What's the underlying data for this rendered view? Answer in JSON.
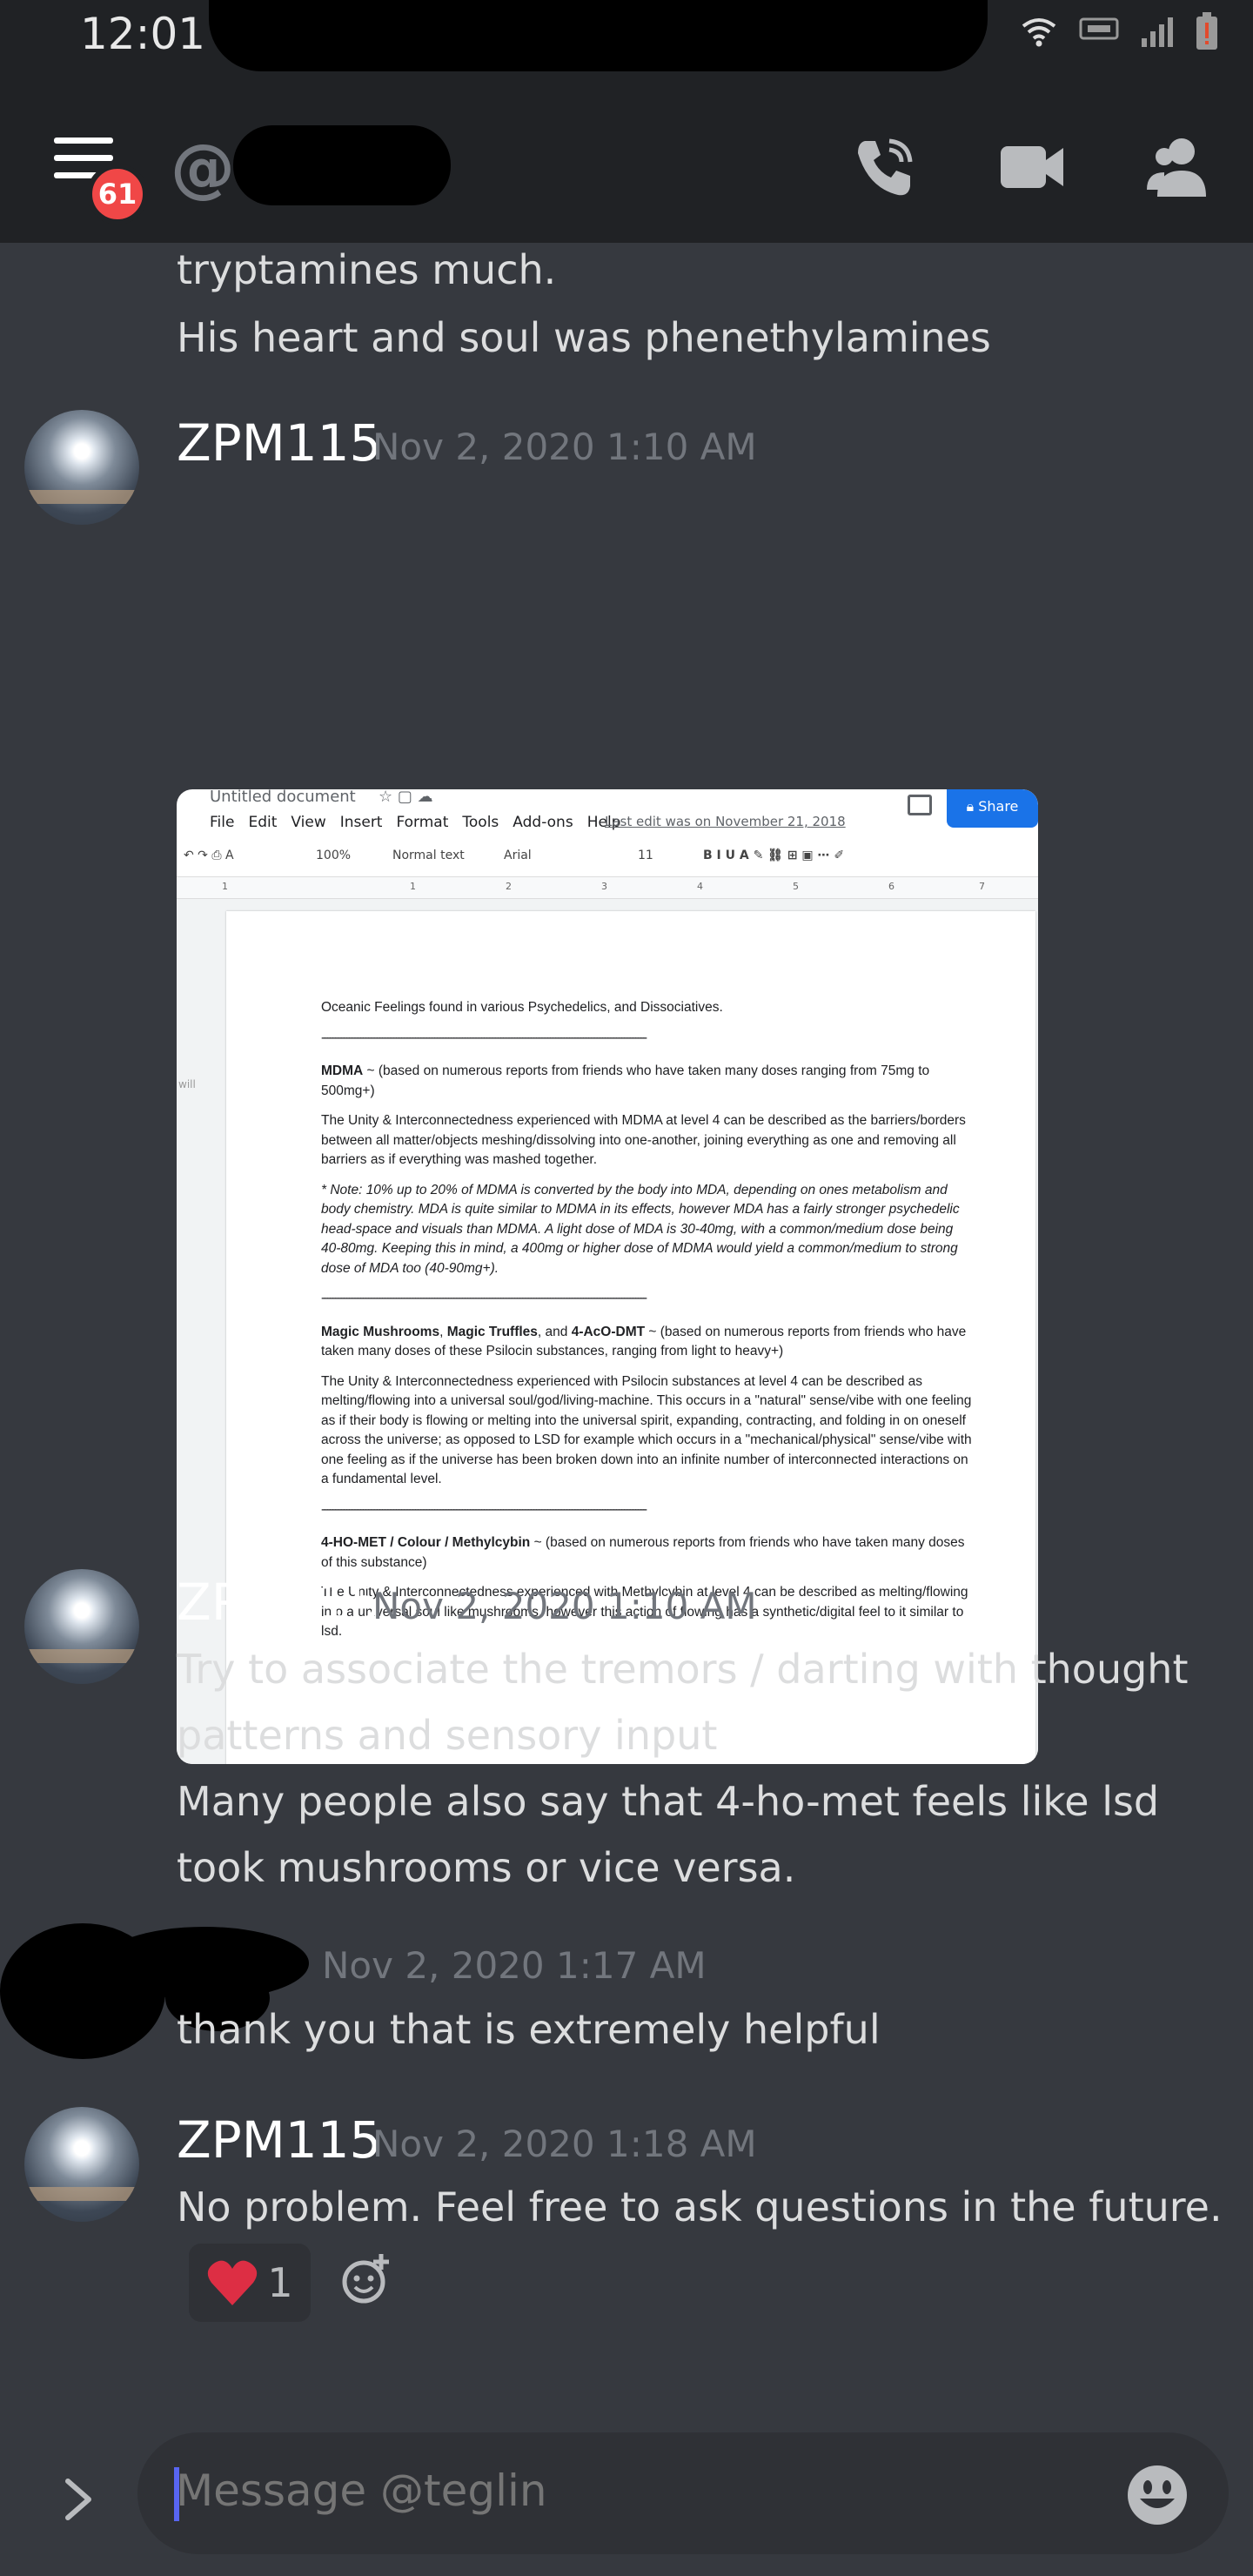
{
  "status_bar": {
    "time": "12:01"
  },
  "header": {
    "unread_badge": "61",
    "at_symbol": "@"
  },
  "messages": {
    "cont_line1": "tryptamines much.",
    "cont_line2": "His heart and soul was phenethylamines",
    "group1": {
      "author": "ZPM115",
      "timestamp": "Nov 2, 2020 1:10 AM"
    },
    "group2": {
      "author": "ZPM115",
      "timestamp": "Nov 2, 2020 1:10 AM",
      "line1": "Try to associate the tremors / darting with thought",
      "line2": "patterns and sensory input",
      "line3": "Many people also say that 4-ho-met feels like lsd",
      "line4": "took mushrooms or vice versa."
    },
    "group3": {
      "timestamp": "Nov 2, 2020 1:17 AM",
      "line1": "thank you that is extremely helpful"
    },
    "group4": {
      "author": "ZPM115",
      "timestamp": "Nov 2, 2020 1:18 AM",
      "line1": "No problem. Feel free to ask questions in the future.",
      "reaction_count": "1"
    }
  },
  "attachment": {
    "doc_title": "Untitled document",
    "menu": [
      "File",
      "Edit",
      "View",
      "Insert",
      "Format",
      "Tools",
      "Add-ons",
      "Help"
    ],
    "last_edit": "Last edit was on November 21, 2018",
    "share": "Share",
    "zoom": "100%",
    "style": "Normal text",
    "font": "Arial",
    "font_size": "11",
    "side_note": "will",
    "ruler": [
      "1",
      "1",
      "2",
      "3",
      "4",
      "5",
      "6",
      "7"
    ],
    "heading": "Oceanic Feelings found in various Psychedelics, and Dissociatives.",
    "separator": "----------------------------------------------------------------------------------------------------------------------",
    "p1_bold": "MDMA",
    "p1_rest": " ~ (based on numerous reports from friends who have taken many doses ranging from 75mg to 500mg+)",
    "p2": "The Unity & Interconnectedness experienced with MDMA at level 4 can be described as the barriers/borders between all matter/objects meshing/dissolving into one-another, joining everything as one and removing all barriers as if everything was mashed together.",
    "p3": "* Note: 10% up to 20% of MDMA is converted by the body into MDA, depending on ones metabolism and body chemistry. MDA is quite similar to MDMA in its effects, however MDA has a fairly stronger psychedelic head-space and visuals than MDMA. A light dose of MDA is 30-40mg, with a common/medium dose being 40-80mg. Keeping this in mind, a 400mg or higher dose of MDMA would yield a common/medium to strong dose of MDA too (40-90mg+).",
    "p4_b1": "Magic Mushrooms",
    "p4_t1": ", ",
    "p4_b2": "Magic Truffles",
    "p4_t2": ", and ",
    "p4_b3": "4-AcO-DMT",
    "p4_rest": " ~ (based on numerous reports from friends who have taken many doses of these Psilocin substances, ranging from light to heavy+)",
    "p5": "The Unity & Interconnectedness experienced with Psilocin substances at level 4 can be described as melting/flowing into a universal soul/god/living-machine. This occurs in a \"natural\" sense/vibe with one feeling as if their body is flowing or melting into the universal spirit, expanding, contracting, and folding in on oneself across the universe; as opposed to LSD for example which occurs in a \"mechanical/physical\" sense/vibe with one feeling as if the universe has been broken down into an infinite number of interconnected interactions on a fundamental level.",
    "p6_bold": "4-HO-MET / Colour / Methylcybin",
    "p6_rest": " ~ (based on numerous reports from friends who have taken many doses of this substance)",
    "p7": "The Unity & Interconnectedness experienced with Methylcybin at level 4 can be described as melting/flowing into a universal soul like mushrooms, however this action of flowing has a synthetic/digital feel to it similar to lsd."
  },
  "composer": {
    "placeholder": "Message @teglin"
  },
  "colors": {
    "background": "#36393f",
    "header": "#202225",
    "badge": "#f04747",
    "accent": "#5865f2",
    "share_button": "#1a73e8"
  }
}
